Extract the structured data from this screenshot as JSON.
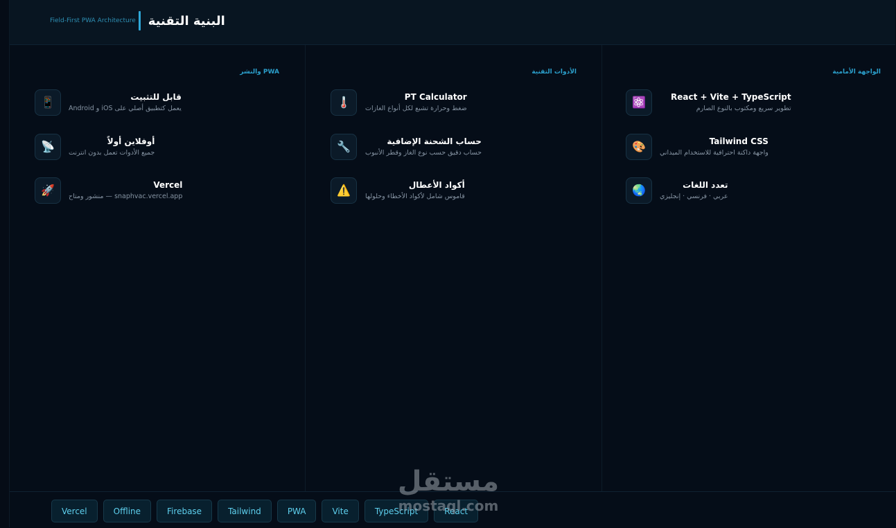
{
  "header": {
    "subtitle": "Field-First PWA Architecture",
    "title": "البنية التقنية"
  },
  "columns": [
    {
      "title": "الواجهة الأمامية",
      "items": [
        {
          "icon": "atom-icon",
          "glyph": "⚛️",
          "title": "React + Vite + TypeScript",
          "desc": "تطوير سريع ومكتوب بالنوع الصارم"
        },
        {
          "icon": "palette-icon",
          "glyph": "🎨",
          "title": "Tailwind CSS",
          "desc": "واجهة داكنة احترافية للاستخدام الميداني"
        },
        {
          "icon": "globe-icon",
          "glyph": "🌏",
          "title": "تعدد اللغات",
          "desc": "عربي · فرنسي · إنجليزي"
        }
      ]
    },
    {
      "title": "الأدوات التقنية",
      "items": [
        {
          "icon": "thermometer-icon",
          "glyph": "🌡️",
          "title": "PT Calculator",
          "desc": "ضغط وحرارة تشبع لكل أنواع الغازات"
        },
        {
          "icon": "wrench-icon",
          "glyph": "🔧",
          "title": "حساب الشحنة الإضافية",
          "desc": "حساب دقيق حسب نوع الغاز وقطر الأنبوب"
        },
        {
          "icon": "warning-icon",
          "glyph": "⚠️",
          "title": "أكواد الأعطال",
          "desc": "قاموس شامل لأكواد الأخطاء وحلولها"
        }
      ]
    },
    {
      "title": "PWA  والنشر",
      "items": [
        {
          "icon": "phone-icon",
          "glyph": "📱",
          "title": "قابل للتثبيت",
          "desc": "يعمل كتطبيق أصلي على iOS و Android"
        },
        {
          "icon": "satellite-icon",
          "glyph": "📡",
          "title": "أوفلاين أولاً",
          "desc": "جميع الأدوات تعمل بدون انترنت"
        },
        {
          "icon": "rocket-icon",
          "glyph": "🚀",
          "title": "Vercel",
          "desc": "snaphvac.vercel.app — منشور ومتاح"
        }
      ]
    }
  ],
  "tags": [
    "Vercel",
    "Offline",
    "Firebase",
    "Tailwind",
    "PWA",
    "Vite",
    "TypeScript",
    "React"
  ],
  "watermark": {
    "arabic": "مستقل",
    "latin": "mostaql.com"
  },
  "colors": {
    "background": "#050d18",
    "accent": "#2fa8d8",
    "tag_text": "#5ed0ee"
  }
}
